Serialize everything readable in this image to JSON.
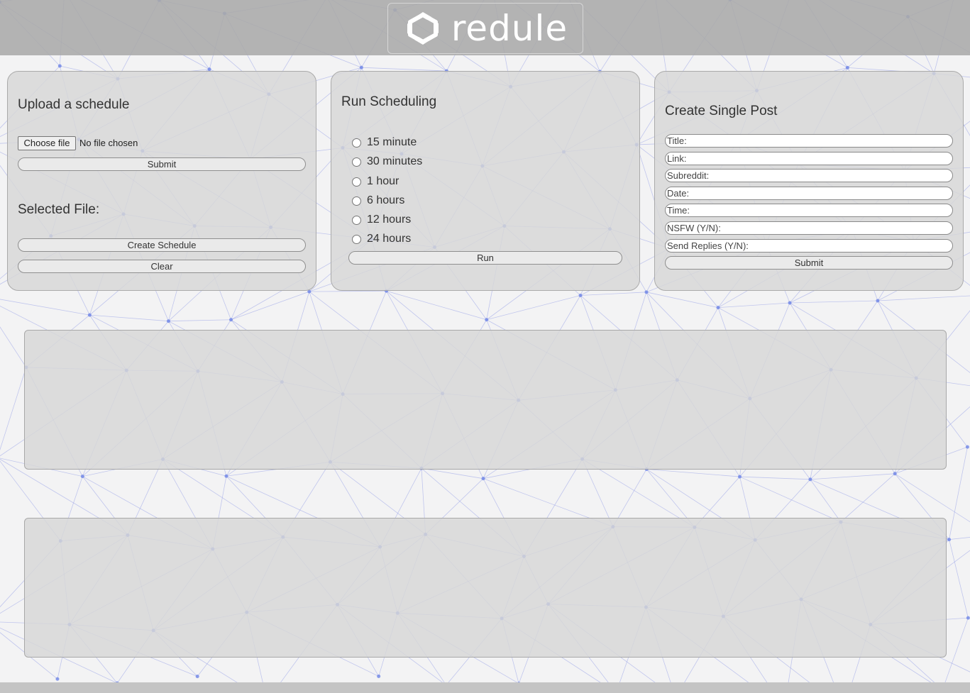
{
  "header": {
    "logo_text": "redule",
    "logo_icon": "hexagon-swirl-logo-icon"
  },
  "upload_card": {
    "title": "Upload a schedule",
    "choose_file_label": "Choose file",
    "no_file_text": "No file chosen",
    "submit_label": "Submit",
    "selected_file_label": "Selected File:",
    "create_schedule_label": "Create Schedule",
    "clear_label": "Clear"
  },
  "run_card": {
    "title": "Run Scheduling",
    "options": [
      "15 minute",
      "30 minutes",
      "1 hour",
      "6 hours",
      "12 hours",
      "24 hours"
    ],
    "run_label": "Run"
  },
  "post_card": {
    "title": "Create Single Post",
    "fields": [
      "Title:",
      "Link:",
      "Subreddit:",
      "Date:",
      "Time:",
      "NSFW (Y/N):",
      "Send Replies (Y/N):"
    ],
    "submit_label": "Submit"
  },
  "colors": {
    "background": "#f3f3f4",
    "header": "#aaaaaa",
    "card": "#d7d7d7",
    "network_line": "#9fa8e8",
    "network_node": "#6f86e6"
  }
}
